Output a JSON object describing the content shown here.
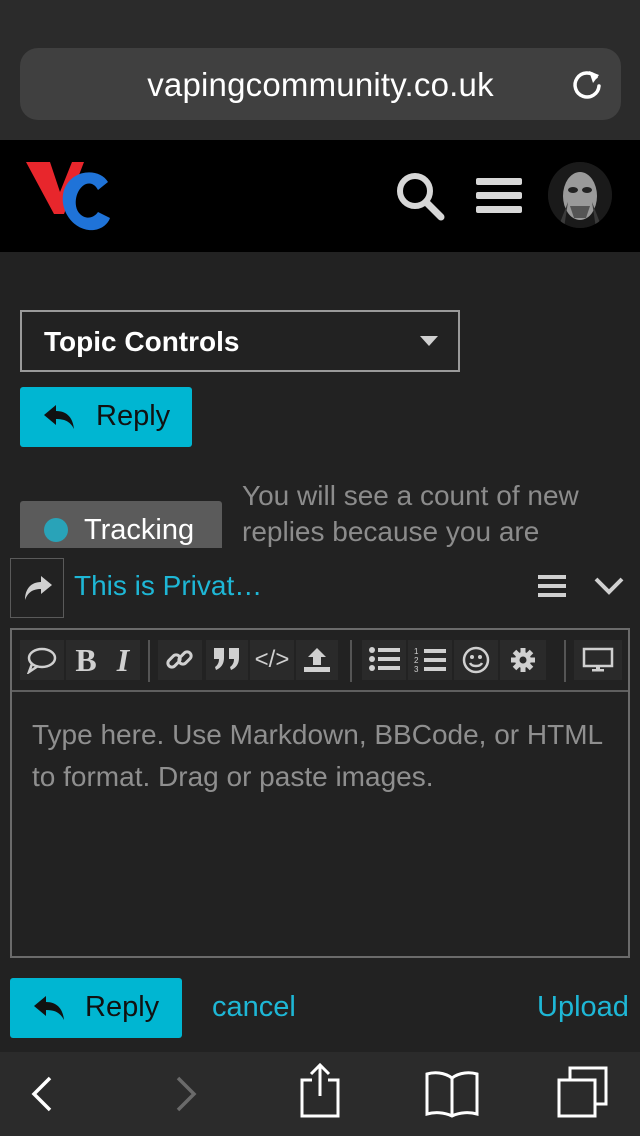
{
  "browser": {
    "url": "vapingcommunity.co.uk"
  },
  "site": {
    "logo_text": "VC"
  },
  "topic": {
    "controls_label": "Topic Controls",
    "reply_label": "Reply",
    "tracking_label": "Tracking",
    "tracking_note": "You will see a count of new replies because you are"
  },
  "composer": {
    "title": "This is Privat…",
    "placeholder": "Type here. Use Markdown, BBCode, or HTML to format. Drag or paste images.",
    "toolbar": {
      "bold": "B",
      "italic": "I",
      "code": "</>"
    },
    "reply_label": "Reply",
    "cancel_label": "cancel",
    "upload_label": "Upload"
  },
  "colors": {
    "accent": "#00b6d2",
    "link": "#1eb7d6",
    "tracking_dot": "#29a3b8"
  }
}
